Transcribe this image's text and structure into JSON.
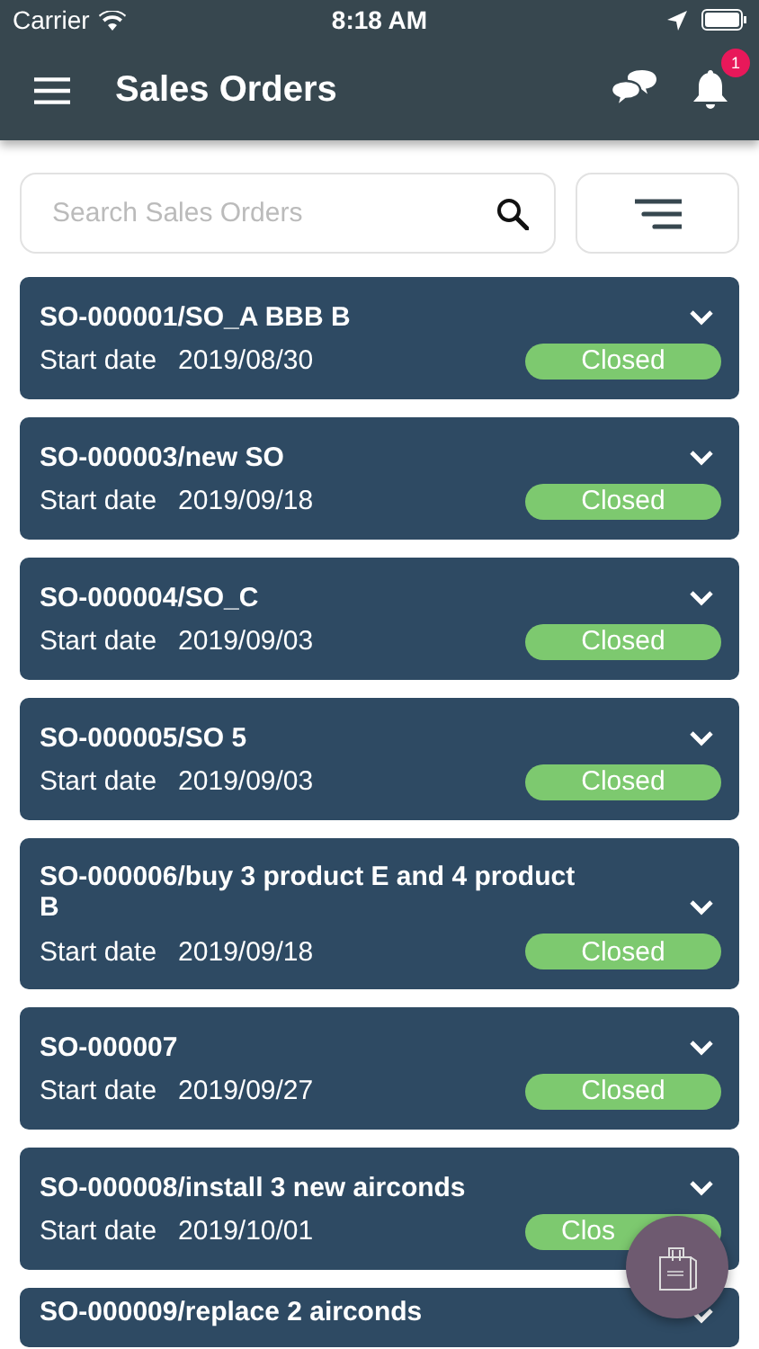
{
  "status_bar": {
    "carrier": "Carrier",
    "time": "8:18 AM"
  },
  "header": {
    "title": "Sales Orders",
    "notification_count": "1"
  },
  "search": {
    "placeholder": "Search Sales Orders"
  },
  "orders": [
    {
      "title": "SO-000001/SO_A BBB B",
      "date_label": "Start date",
      "date": "2019/08/30",
      "status": "Closed"
    },
    {
      "title": "SO-000003/new SO",
      "date_label": "Start date",
      "date": "2019/09/18",
      "status": "Closed"
    },
    {
      "title": "SO-000004/SO_C",
      "date_label": "Start date",
      "date": "2019/09/03",
      "status": "Closed"
    },
    {
      "title": "SO-000005/SO 5",
      "date_label": "Start date",
      "date": "2019/09/03",
      "status": "Closed"
    },
    {
      "title": "SO-000006/buy 3 product E and 4 product B",
      "date_label": "Start date",
      "date": "2019/09/18",
      "status": "Closed"
    },
    {
      "title": "SO-000007",
      "date_label": "Start date",
      "date": "2019/09/27",
      "status": "Closed"
    },
    {
      "title": "SO-000008/install 3 new airconds",
      "date_label": "Start date",
      "date": "2019/10/01",
      "status": "Clos"
    },
    {
      "title": "SO-000009/replace 2 airconds"
    }
  ]
}
